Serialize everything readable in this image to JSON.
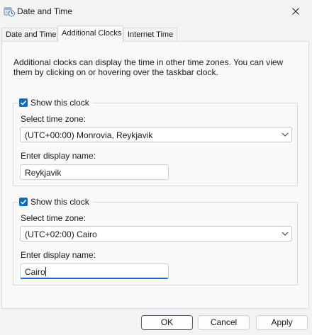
{
  "window": {
    "title": "Date and Time",
    "app_icon": "date-time-icon",
    "close_icon": "close-icon"
  },
  "tabs": [
    {
      "label": "Date and Time",
      "active": false
    },
    {
      "label": "Additional Clocks",
      "active": true
    },
    {
      "label": "Internet Time",
      "active": false
    }
  ],
  "intro": "Additional clocks can display the time in other time zones. You can view them by clicking on or hovering over the taskbar clock.",
  "clock1": {
    "show_label": "Show this clock",
    "show_checked": true,
    "tz_label": "Select time zone:",
    "tz_value": "(UTC+00:00) Monrovia, Reykjavik",
    "name_label": "Enter display name:",
    "name_value": "Reykjavik"
  },
  "clock2": {
    "show_label": "Show this clock",
    "show_checked": true,
    "tz_label": "Select time zone:",
    "tz_value": "(UTC+02:00) Cairo",
    "name_label": "Enter display name:",
    "name_value": "Cairo"
  },
  "buttons": {
    "ok": "OK",
    "cancel": "Cancel",
    "apply": "Apply"
  },
  "colors": {
    "accent": "#0f6cbd",
    "window_bg": "#f3f3f3",
    "panel_bg": "#f9f9f9"
  }
}
